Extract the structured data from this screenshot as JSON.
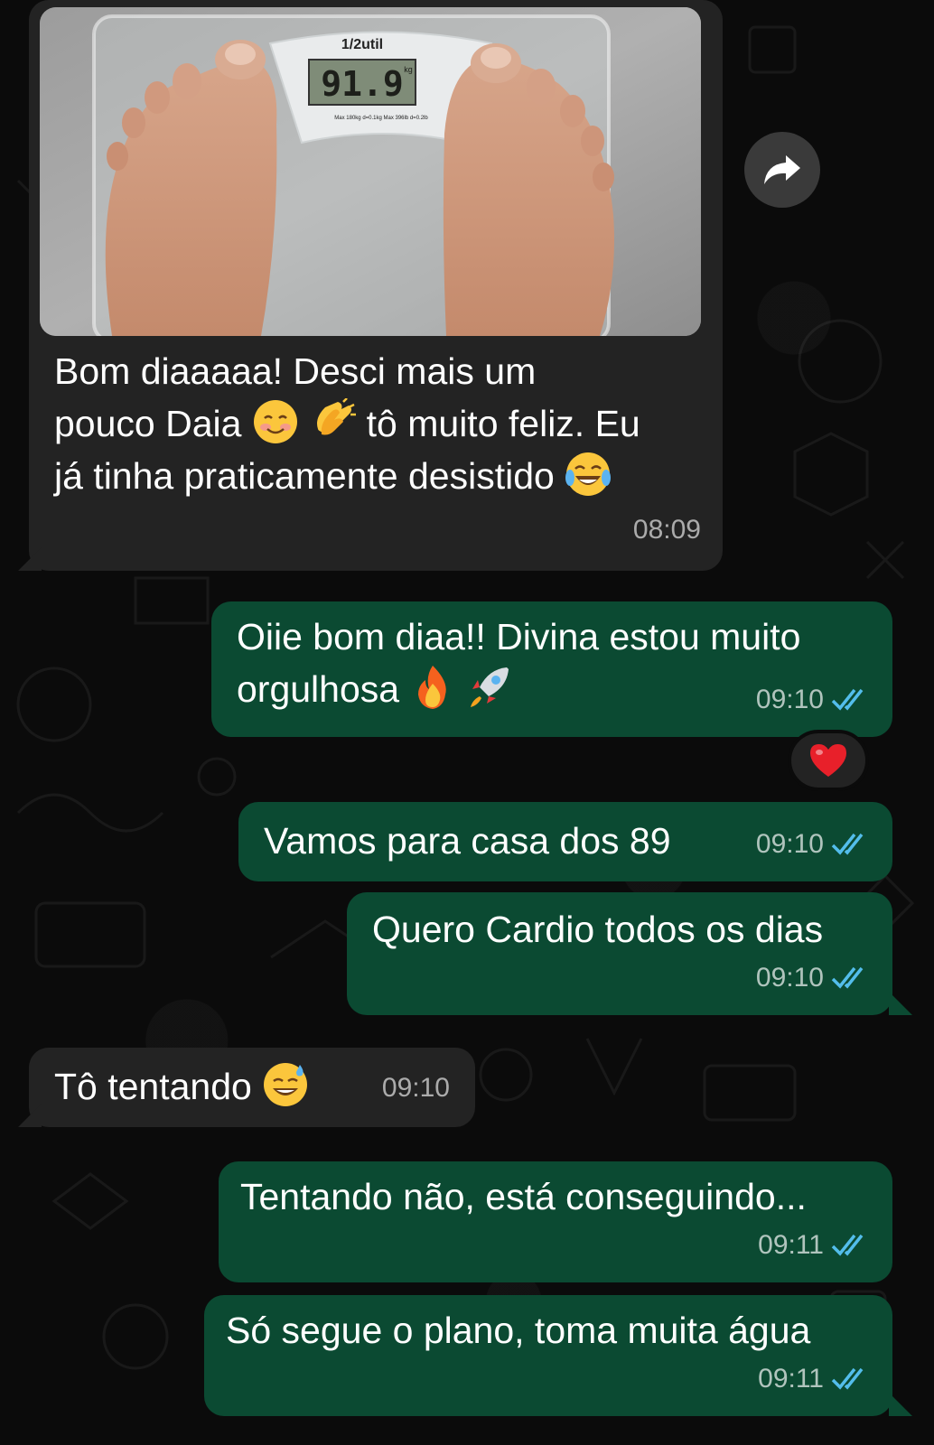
{
  "messages": [
    {
      "id": "m1",
      "direction": "incoming",
      "has_photo": true,
      "photo_scale_brand": "1/2util",
      "photo_scale_display": "91.9",
      "photo_scale_unit": "kg",
      "photo_scale_spec": "Max 180kg d=0.1kg Max 396lb d=0.2lb",
      "lines": [
        "Bom diaaaaa! Desci mais um",
        "pouco Daia",
        "tô muito feliz. Eu",
        "já tinha praticamente desistido"
      ],
      "emojis": [
        "smiling-blush-emoji",
        "clapping-hands-emoji",
        "tears-of-joy-emoji"
      ],
      "time": "08:09"
    },
    {
      "id": "m2",
      "direction": "outgoing",
      "lines": [
        "Oiie bom diaa!! Divina estou muito",
        "orgulhosa"
      ],
      "emojis": [
        "fire-emoji",
        "rocket-emoji"
      ],
      "time": "09:10",
      "status": "read",
      "reaction": "red-heart-emoji"
    },
    {
      "id": "m3",
      "direction": "outgoing",
      "lines": [
        "Vamos para casa dos 89"
      ],
      "time": "09:10",
      "status": "read"
    },
    {
      "id": "m4",
      "direction": "outgoing",
      "lines": [
        "Quero Cardio todos os dias"
      ],
      "time": "09:10",
      "status": "read"
    },
    {
      "id": "m5",
      "direction": "incoming",
      "lines": [
        "Tô tentando"
      ],
      "emojis": [
        "sweat-smile-emoji"
      ],
      "time": "09:10"
    },
    {
      "id": "m6",
      "direction": "outgoing",
      "lines": [
        "Tentando não, está conseguindo..."
      ],
      "time": "09:11",
      "status": "read"
    },
    {
      "id": "m7",
      "direction": "outgoing",
      "lines": [
        "Só segue o plano, toma muita água"
      ],
      "time": "09:11",
      "status": "read"
    }
  ],
  "icons": {
    "forward": "forward-arrow-icon",
    "read_receipt": "double-check-icon"
  },
  "colors": {
    "background": "#0b0b0b",
    "incoming_bubble": "#232323",
    "outgoing_bubble": "#0b4a32",
    "read_tick": "#53bdeb",
    "reaction_heart": "#e8202a"
  }
}
